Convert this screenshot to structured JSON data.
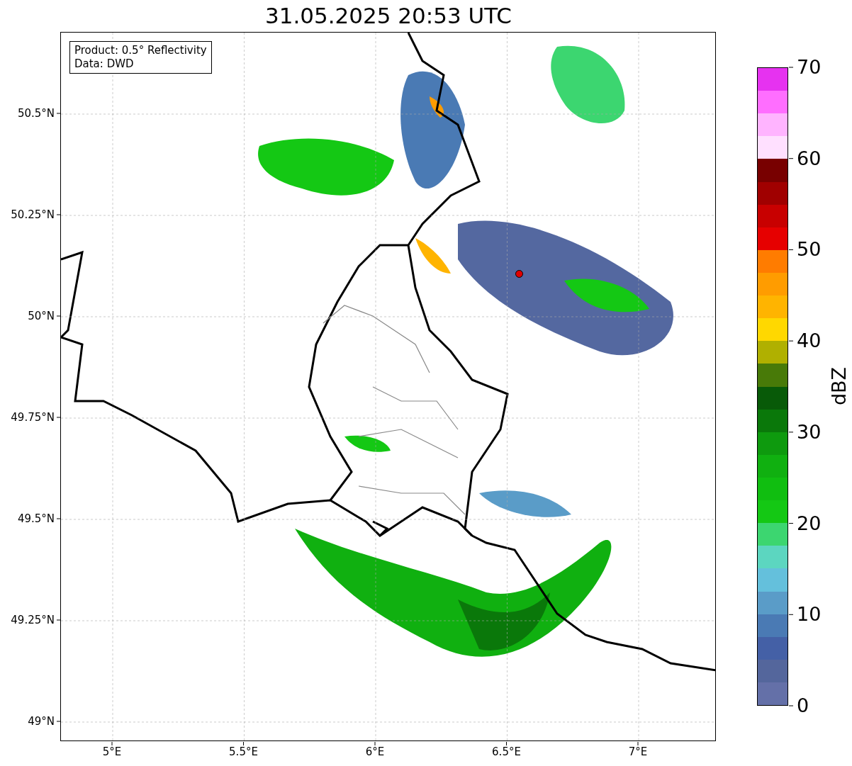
{
  "title": "31.05.2025 20:53 UTC",
  "info_box": {
    "lines": [
      "Product: 0.5° Reflectivity",
      "Data: DWD"
    ]
  },
  "map": {
    "yticks": [
      "50.5°N",
      "50.25°N",
      "50°N",
      "49.75°N",
      "49.5°N",
      "49.25°N",
      "49°N"
    ],
    "xticks": [
      "5°E",
      "5.5°E",
      "6°E",
      "6.5°E",
      "7°E"
    ]
  },
  "colorbar": {
    "label": "dBZ",
    "ticks": [
      "70",
      "60",
      "50",
      "40",
      "30",
      "20",
      "10",
      "0"
    ],
    "bands": [
      {
        "color": "#e632f0"
      },
      {
        "color": "#ff6eff"
      },
      {
        "color": "#ffb4ff"
      },
      {
        "color": "#ffe0ff"
      },
      {
        "color": "#780000"
      },
      {
        "color": "#a00000"
      },
      {
        "color": "#c80000"
      },
      {
        "color": "#e60000"
      },
      {
        "color": "#ff7c00"
      },
      {
        "color": "#ff9c00"
      },
      {
        "color": "#ffb400"
      },
      {
        "color": "#ffd800"
      },
      {
        "color": "#b0b000"
      },
      {
        "color": "#487a08"
      },
      {
        "color": "#085a08"
      },
      {
        "color": "#0a780a"
      },
      {
        "color": "#0e9a0e"
      },
      {
        "color": "#10b010"
      },
      {
        "color": "#10be10"
      },
      {
        "color": "#14c814"
      },
      {
        "color": "#3cd670"
      },
      {
        "color": "#5cd6c0"
      },
      {
        "color": "#64c0dc"
      },
      {
        "color": "#5a9cc8"
      },
      {
        "color": "#4a7ab4"
      },
      {
        "color": "#4460a6"
      },
      {
        "color": "#54669c"
      },
      {
        "color": "#6470a8"
      }
    ]
  }
}
